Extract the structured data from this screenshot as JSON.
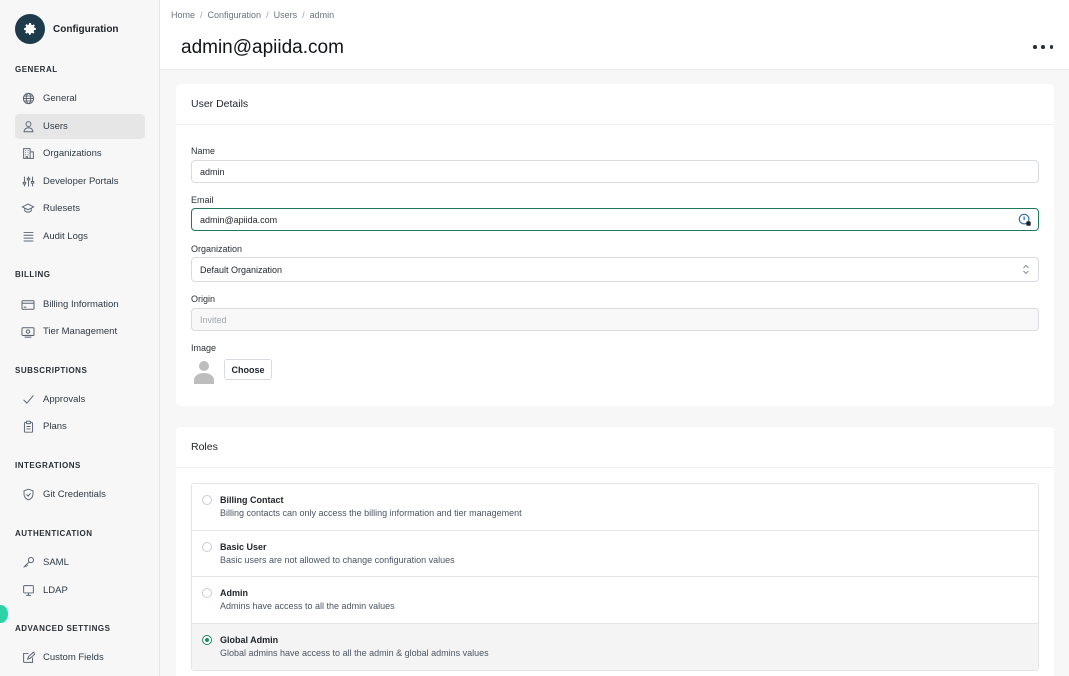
{
  "app": {
    "title": "Configuration"
  },
  "sidebar": {
    "sections": [
      {
        "title": "GENERAL",
        "items": [
          {
            "label": "General",
            "icon": "globe-icon"
          },
          {
            "label": "Users",
            "icon": "user-icon",
            "active": true
          },
          {
            "label": "Organizations",
            "icon": "building-icon"
          },
          {
            "label": "Developer Portals",
            "icon": "sliders-icon"
          },
          {
            "label": "Rulesets",
            "icon": "graduation-cap-icon"
          },
          {
            "label": "Audit Logs",
            "icon": "list-icon"
          }
        ]
      },
      {
        "title": "BILLING",
        "items": [
          {
            "label": "Billing Information",
            "icon": "credit-card-icon"
          },
          {
            "label": "Tier Management",
            "icon": "money-icon"
          }
        ]
      },
      {
        "title": "SUBSCRIPTIONS",
        "items": [
          {
            "label": "Approvals",
            "icon": "check-icon"
          },
          {
            "label": "Plans",
            "icon": "clipboard-icon"
          }
        ]
      },
      {
        "title": "INTEGRATIONS",
        "items": [
          {
            "label": "Git Credentials",
            "icon": "shield-icon"
          }
        ]
      },
      {
        "title": "AUTHENTICATION",
        "items": [
          {
            "label": "SAML",
            "icon": "key-icon"
          },
          {
            "label": "LDAP",
            "icon": "monitor-icon"
          }
        ]
      },
      {
        "title": "ADVANCED SETTINGS",
        "items": [
          {
            "label": "Custom Fields",
            "icon": "edit-fields-icon"
          }
        ]
      }
    ]
  },
  "breadcrumb": [
    "Home",
    "Configuration",
    "Users",
    "admin"
  ],
  "page": {
    "title": "admin@apiida.com"
  },
  "user_details": {
    "title": "User Details",
    "name_label": "Name",
    "name_value": "admin",
    "email_label": "Email",
    "email_value": "admin@apiida.com",
    "org_label": "Organization",
    "org_value": "Default Organization",
    "origin_label": "Origin",
    "origin_placeholder": "Invited",
    "image_label": "Image",
    "choose_label": "Choose"
  },
  "roles": {
    "title": "Roles",
    "items": [
      {
        "name": "Billing Contact",
        "desc": "Billing contacts can only access the billing information and tier management",
        "selected": false
      },
      {
        "name": "Basic User",
        "desc": "Basic users are not allowed to change configuration values",
        "selected": false
      },
      {
        "name": "Admin",
        "desc": "Admins have access to all the admin values",
        "selected": false
      },
      {
        "name": "Global Admin",
        "desc": "Global admins have access to all the admin & global admins values",
        "selected": true
      }
    ]
  },
  "colors": {
    "accent": "#1e8a62",
    "brand": "#1d3b4a",
    "floating_dot": "#2dd3a6"
  }
}
